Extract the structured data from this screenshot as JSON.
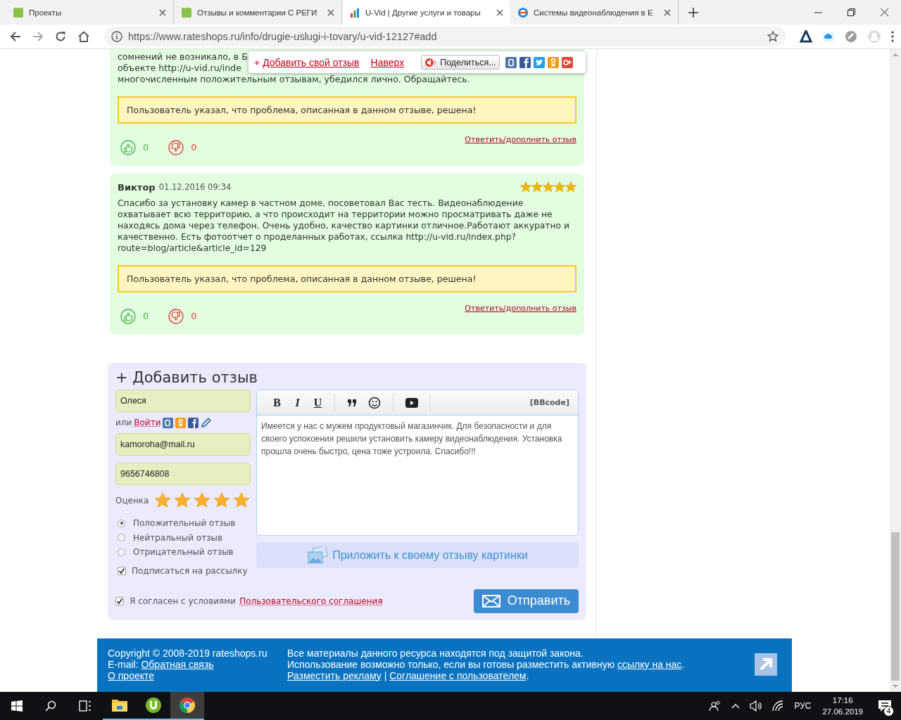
{
  "browser": {
    "tabs": [
      {
        "title": "Проекты",
        "selected": false
      },
      {
        "title": "Отзывы и комментарии С РЕГИ",
        "selected": false
      },
      {
        "title": "U-Vid | Другие услуги и товары",
        "selected": true
      },
      {
        "title": "Системы видеонаблюдения в Е",
        "selected": false
      }
    ],
    "url": "https://www.rateshops.ru/info/drugie-uslugi-i-tovary/u-vid-12127#add"
  },
  "popup": {
    "plus": "+",
    "add_link": "Добавить свой отзыв",
    "top_link": "Наверх",
    "share_button": "Поделиться..."
  },
  "reviews": [
    {
      "text_lines": [
        "сомнений не возникало, в Б",
        "объекте http://u-vid.ru/inde",
        "многочисленным положительным отзывам, убедился лично. Обращайтесь."
      ],
      "resolved_notice": "Пользователь указал, что проблема, описанная в данном отзыве, решена!",
      "likes": "0",
      "dislikes": "0",
      "reply_link": "Ответить/дополнить отзыв"
    },
    {
      "author": "Виктор",
      "date": "01.12.2016 09:34",
      "stars": 5,
      "text": "Спасибо за установку камер в частном доме, посоветовал Вас тесть. Видеонаблюдение охватывает всю территорию, а что происходит на территории можно просматривать даже не находясь дома через телефон. Очень удобно, качество картинки отличное.Работают аккуратно и качественно. Есть фотоотчет о проделанных работах, ссылка http://u-vid.ru/index.php?route=blog/article&article_id=129",
      "resolved_notice": "Пользователь указал, что проблема, описанная в данном отзыве, решена!",
      "likes": "0",
      "dislikes": "0",
      "reply_link": "Ответить/дополнить отзыв"
    }
  ],
  "form": {
    "title": "+ Добавить отзыв",
    "name": "Олеся",
    "login_prefix": "или",
    "login_link": "Войти",
    "email": "kamoroha@mail.ru",
    "phone": "9656746808",
    "rating_label": "Оценка",
    "stars": 5,
    "radios": [
      {
        "label": "Положительный отзыв",
        "selected": true
      },
      {
        "label": "Нейтральный отзыв",
        "selected": false
      },
      {
        "label": "Отрицательный отзыв",
        "selected": false
      }
    ],
    "subscribe": {
      "label": "Подписаться на рассылку",
      "checked": true
    },
    "format_buttons": [
      "B",
      "I",
      "U"
    ],
    "bbcode_label": "[BBcode]",
    "review_text": "Имеется у нас с мужем продуктовый магазинчик. Для безопасности и для своего успокоения решили установить камеру видеонаблюдения. Установка прошла очень быстро, цена тоже устроила. Спасибо!!!",
    "attach_button": "Приложить к своему отзыву картинки",
    "agree": {
      "text": "Я согласен с условиями",
      "link": "Пользовательского соглашения",
      "checked": true
    },
    "submit": "Отправить"
  },
  "footer": {
    "copyright": "Copyright © 2008-2019 rateshops.ru",
    "email_label": "E-mail:",
    "feedback_link": "Обратная связь",
    "about_link": "О проекте",
    "notice": "Все материалы данного ресурса находятся под защитой закона.",
    "usage_text": "Использование возможно только, если вы готовы разместить активную",
    "usage_link": "ссылку на нас",
    "usage_end": ".",
    "ads_link": "Разместить рекламу",
    "separator": "|",
    "agreement_link": "Соглашение с пользователем",
    "links_end": "."
  },
  "taskbar": {
    "apps": [
      {
        "kind": "folder",
        "selected": false
      },
      {
        "kind": "torrent",
        "selected": false
      },
      {
        "kind": "browser",
        "selected": true
      }
    ],
    "language": "РУС",
    "time": "17:16",
    "date": "27.06.2019",
    "notifications": "4"
  }
}
